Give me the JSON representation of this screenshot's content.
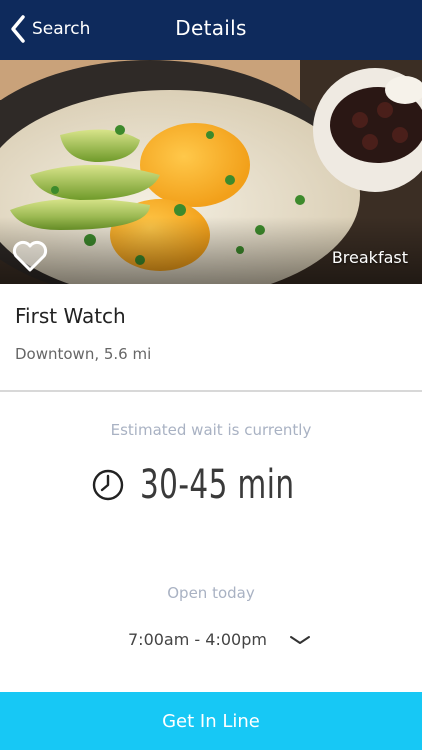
{
  "nav": {
    "back_label": "Search",
    "title": "Details",
    "back_icon": "chevron-left-icon"
  },
  "hero": {
    "category": "Breakfast",
    "favorite_icon": "heart-icon",
    "favorited": false
  },
  "restaurant": {
    "name": "First Watch",
    "location": "Downtown, 5.6 mi"
  },
  "wait": {
    "caption": "Estimated wait is currently",
    "value": "30-45 min",
    "icon": "clock-icon"
  },
  "hours": {
    "caption": "Open today",
    "value": "7:00am - 4:00pm",
    "expand_icon": "chevron-down-icon"
  },
  "cta": {
    "label": "Get In Line"
  },
  "colors": {
    "navbar": "#0e2a5c",
    "accent": "#17c8f5",
    "muted_text": "#a9b2c3"
  }
}
